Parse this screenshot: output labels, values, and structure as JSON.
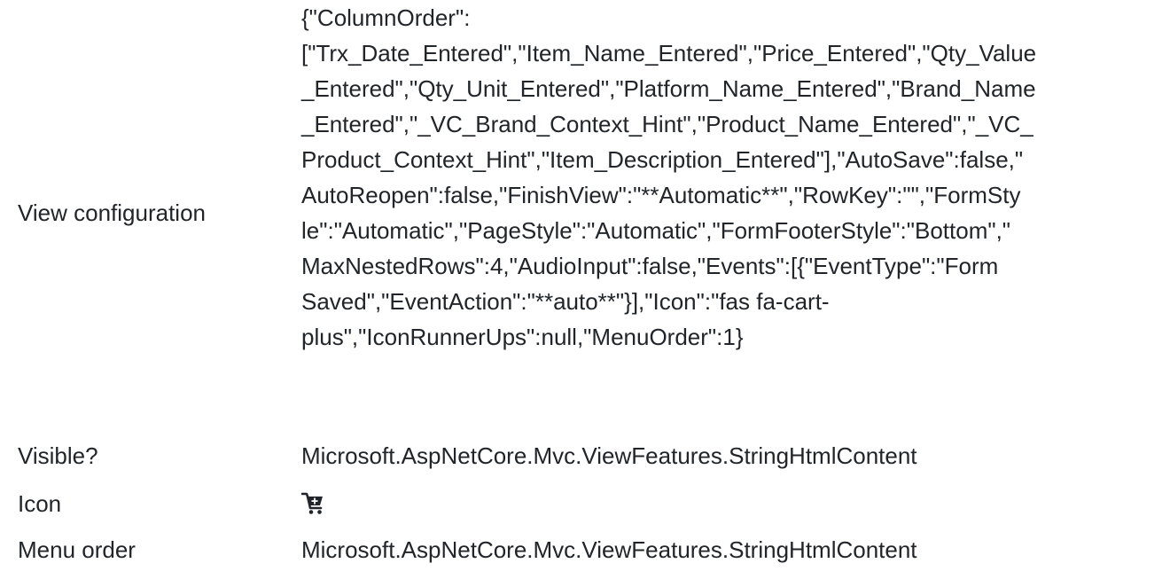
{
  "properties": {
    "view_config": {
      "label": "View configuration",
      "value_lines": [
        "{\"ColumnOrder\":",
        "[\"Trx_Date_Entered\",\"Item_Name_Entered\",\"Price_Entered\",\"Qty_Value",
        "_Entered\",\"Qty_Unit_Entered\",\"Platform_Name_Entered\",\"Brand_Name",
        "_Entered\",\"_VC_Brand_Context_Hint\",\"Product_Name_Entered\",\"_VC_",
        "Product_Context_Hint\",\"Item_Description_Entered\"],\"AutoSave\":false,\"",
        "AutoReopen\":false,\"FinishView\":\"**Automatic**\",\"RowKey\":\"\",\"FormSty",
        "le\":\"Automatic\",\"PageStyle\":\"Automatic\",\"FormFooterStyle\":\"Bottom\",\"",
        "MaxNestedRows\":4,\"AudioInput\":false,\"Events\":[{\"EventType\":\"Form",
        "Saved\",\"EventAction\":\"**auto**\"}],\"Icon\":\"fas fa-cart-",
        "plus\",\"IconRunnerUps\":null,\"MenuOrder\":1}"
      ]
    },
    "visible": {
      "label": "Visible?",
      "value": "Microsoft.AspNetCore.Mvc.ViewFeatures.StringHtmlContent"
    },
    "icon": {
      "label": "Icon",
      "icon_name": "cart-plus-icon"
    },
    "menu_order": {
      "label": "Menu order",
      "value": "Microsoft.AspNetCore.Mvc.ViewFeatures.StringHtmlContent"
    }
  }
}
